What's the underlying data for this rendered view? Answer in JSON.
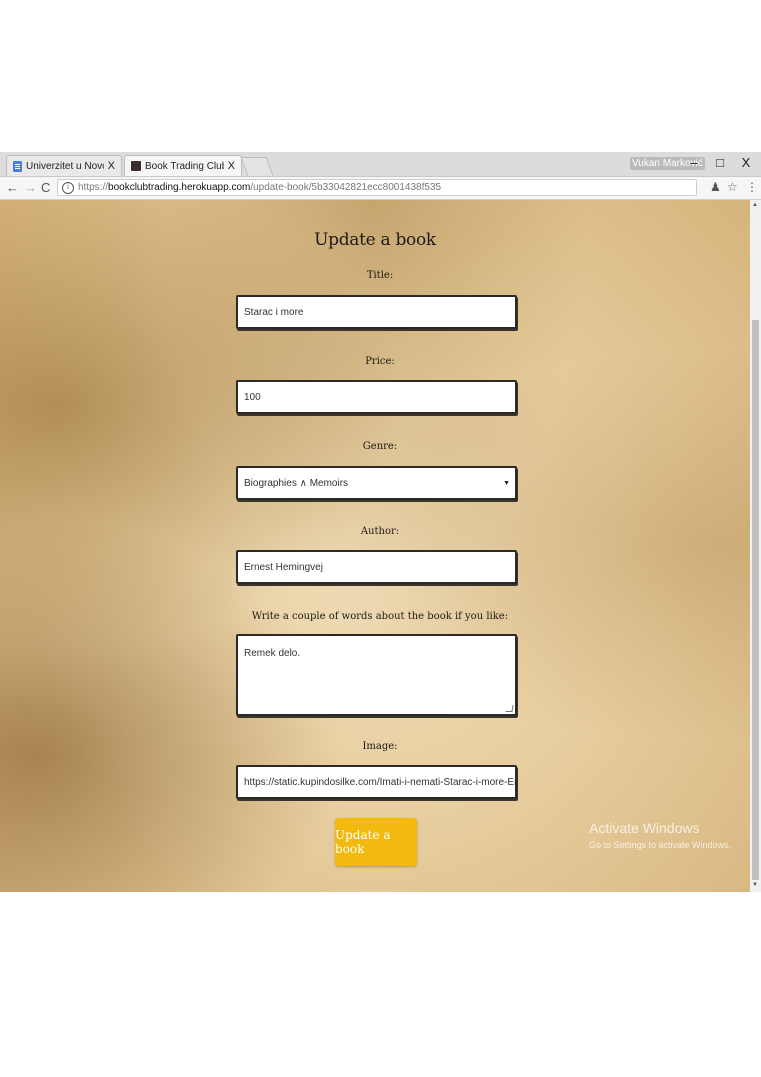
{
  "browser": {
    "tabs": [
      {
        "title": "Univerzitet u Novom Sad",
        "close": "X"
      },
      {
        "title": "Book Trading Club",
        "close": "X"
      }
    ],
    "user": "Vukan Marković",
    "window_controls": {
      "minimize": "–",
      "maximize": "□",
      "close": "X"
    },
    "url": {
      "scheme": "https://",
      "host": "bookclubtrading.herokuapp.com",
      "path": "/update-book/5b33042821ecc8001438f535"
    }
  },
  "page": {
    "title": "Update a book",
    "form": {
      "title_label": "Title:",
      "title_value": "Starac i more",
      "price_label": "Price:",
      "price_value": "100",
      "genre_label": "Genre:",
      "genre_value": "Biographies ∧ Memoirs",
      "author_label": "Author:",
      "author_value": "Ernest Hemingvej",
      "description_label": "Write a couple of words about the book if you like:",
      "description_value": "Remek delo.",
      "image_label": "Image:",
      "image_value": "https://static.kupindosilke.com/Imati-i-nemati-Starac-i-more-Ernest-Hemingv",
      "submit_label": "Update a book"
    },
    "watermark": {
      "line1": "Activate Windows",
      "line2": "Go to Settings to activate Windows."
    }
  },
  "colors": {
    "accent": "#f2b90f",
    "parchment": "#e6cc9c"
  }
}
